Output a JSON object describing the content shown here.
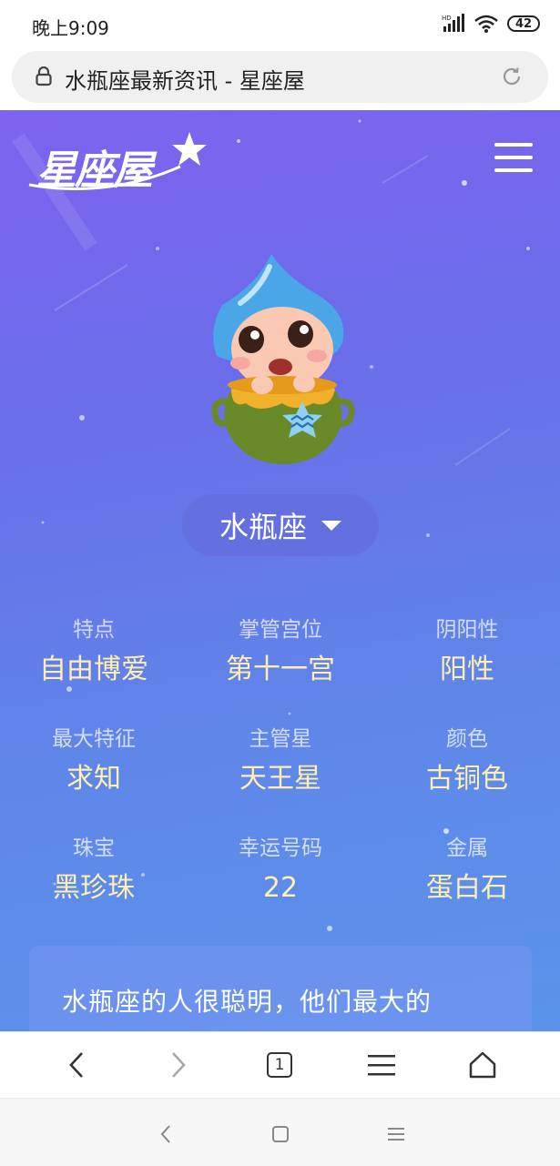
{
  "status_bar": {
    "time": "晚上9:09",
    "network": "HD",
    "battery": "42"
  },
  "browser": {
    "page_title": "水瓶座最新资讯 - 星座屋"
  },
  "header": {
    "logo_text": "星座屋"
  },
  "sign_selector": {
    "selected": "水瓶座"
  },
  "attributes": [
    {
      "label": "特点",
      "value": "自由博爱"
    },
    {
      "label": "掌管宫位",
      "value": "第十一宫"
    },
    {
      "label": "阴阳性",
      "value": "阳性"
    },
    {
      "label": "最大特征",
      "value": "求知"
    },
    {
      "label": "主管星",
      "value": "天王星"
    },
    {
      "label": "颜色",
      "value": "古铜色"
    },
    {
      "label": "珠宝",
      "value": "黑珍珠"
    },
    {
      "label": "幸运号码",
      "value": "22"
    },
    {
      "label": "金属",
      "value": "蛋白石"
    }
  ],
  "description": "水瓶座的人很聪明，他们最大的",
  "colors": {
    "gradient_top": "#7d63ef",
    "gradient_bottom": "#5a94ea",
    "value_text": "#ffefb0"
  }
}
